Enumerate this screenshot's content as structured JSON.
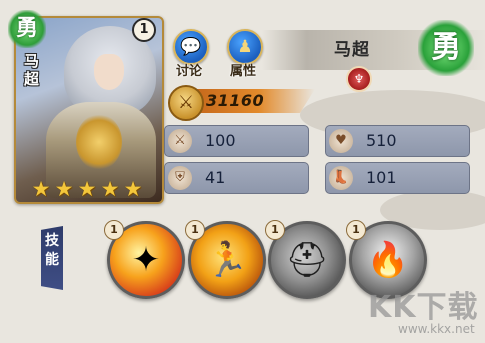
{
  "hero": {
    "name_vertical": "马超",
    "name": "马超",
    "level": "1",
    "stars": 5,
    "type_badge": "勇"
  },
  "buttons": {
    "discuss_label": "讨论",
    "attributes_label": "属性"
  },
  "power": {
    "value": "31160"
  },
  "stats": [
    {
      "icon": "sword-icon",
      "value": "100"
    },
    {
      "icon": "heart-icon",
      "value": "510"
    },
    {
      "icon": "shield-icon",
      "value": "41"
    },
    {
      "icon": "boot-icon",
      "value": "101"
    }
  ],
  "skills": {
    "label": "技能",
    "items": [
      {
        "level": "1",
        "icon": "fire-slash-icon",
        "locked": false
      },
      {
        "level": "1",
        "icon": "charge-icon",
        "locked": false
      },
      {
        "level": "1",
        "icon": "helmet-icon",
        "locked": true
      },
      {
        "level": "1",
        "icon": "flame-icon",
        "locked": true
      }
    ]
  },
  "watermark": {
    "text": "KK下载",
    "url": "www.kkx.net"
  },
  "colors": {
    "power_strip": "#e28a2b",
    "stat_bg": "#9aa2b4",
    "badge_green": "#2aa13a"
  }
}
